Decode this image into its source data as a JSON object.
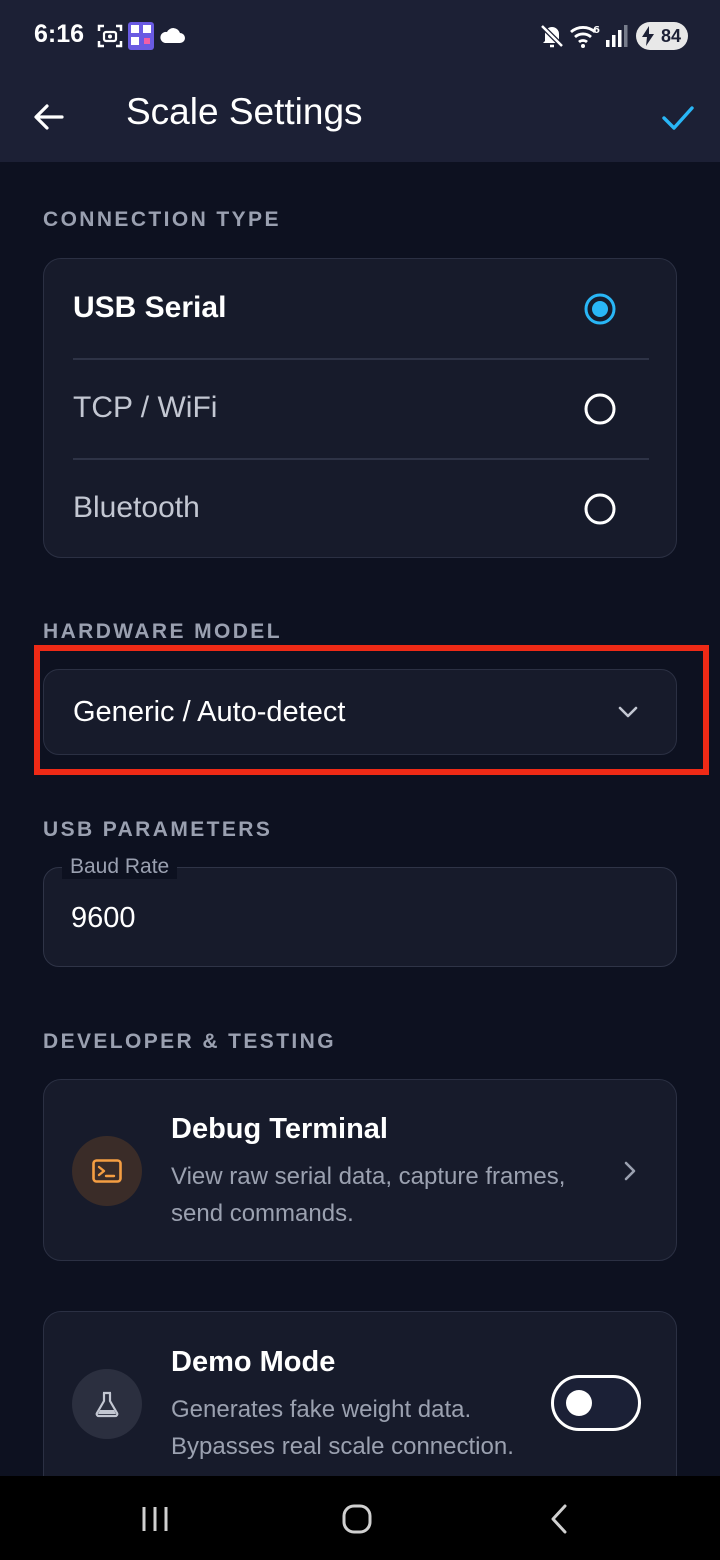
{
  "status_bar": {
    "time": "6:16",
    "battery": "84",
    "notification_icons": [
      "screenshot-icon",
      "qr-app-icon",
      "cloud-icon"
    ],
    "system_icons": [
      "mute-icon",
      "wifi-6-icon",
      "signal-icon",
      "battery-charging-icon"
    ]
  },
  "app_bar": {
    "title": "Scale Settings",
    "back_icon": "arrow-left-icon",
    "confirm_icon": "check-icon",
    "accent_color": "#29b6f6"
  },
  "connection": {
    "section_label": "CONNECTION TYPE",
    "options": [
      {
        "label": "USB Serial",
        "selected": true
      },
      {
        "label": "TCP / WiFi",
        "selected": false
      },
      {
        "label": "Bluetooth",
        "selected": false
      }
    ]
  },
  "hardware": {
    "section_label": "HARDWARE MODEL",
    "selected_value": "Generic / Auto-detect",
    "highlight_color": "#ee2a16"
  },
  "usb": {
    "section_label": "USB PARAMETERS",
    "baud_label": "Baud Rate",
    "baud_value": "9600"
  },
  "developer": {
    "section_label": "DEVELOPER & TESTING",
    "debug": {
      "title": "Debug Terminal",
      "desc_line1": "View raw serial data, capture frames,",
      "desc_line2": "send commands.",
      "icon": "terminal-icon",
      "icon_color": "#f59e42"
    },
    "demo": {
      "title": "Demo Mode",
      "desc_line1": "Generates fake weight data.",
      "desc_line2": "Bypasses real scale connection.",
      "icon": "flask-icon",
      "enabled": false
    }
  },
  "nav_bar": {
    "recents_icon": "recents-icon",
    "home_icon": "home-icon",
    "back_icon": "nav-back-icon"
  }
}
